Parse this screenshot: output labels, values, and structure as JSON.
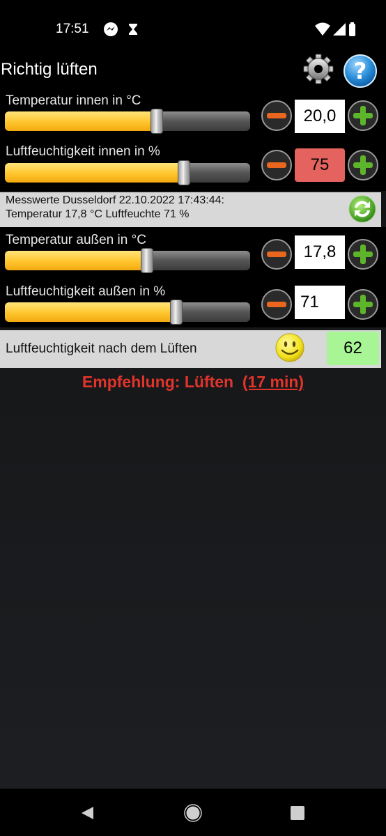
{
  "status_bar": {
    "time": "17:51"
  },
  "app": {
    "title": "Richtig lüften"
  },
  "inside_temp": {
    "label": "Temperatur innen in °C",
    "value": "20,0",
    "slider_level": 0.62
  },
  "inside_humidity": {
    "label": "Luftfeuchtigkeit innen in %",
    "value": "75",
    "slider_level": 0.73
  },
  "measurement": {
    "line1": "Messwerte Dusseldorf 22.10.2022 17:43:44:",
    "line2": "Temperatur  17,8 °C  Luftfeuchte 71 %"
  },
  "outside_temp": {
    "label": "Temperatur außen in °C",
    "value": "17,8",
    "slider_level": 0.58
  },
  "outside_humidity": {
    "label": "Luftfeuchtigkeit außen in %",
    "value": "71",
    "slider_level": 0.7
  },
  "result": {
    "label": "Luftfeuchtigkeit nach dem Lüften",
    "value": "62"
  },
  "recommendation": {
    "text": "Empfehlung: Lüften",
    "time": "(17 min)"
  },
  "colors": {
    "accent_red": "#e2342b",
    "slider_fill": "#ffc52e",
    "alert_red": "#e5635e",
    "ok_green": "#a7f594"
  }
}
